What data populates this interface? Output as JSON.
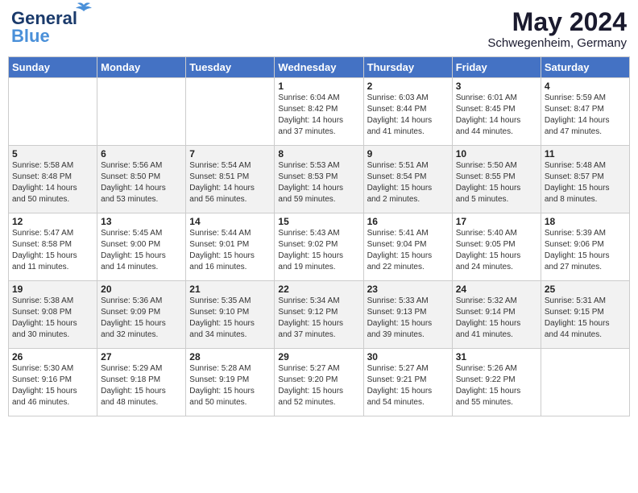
{
  "logo": {
    "line1": "General",
    "line2": "Blue"
  },
  "title": {
    "month_year": "May 2024",
    "location": "Schwegenheim, Germany"
  },
  "weekdays": [
    "Sunday",
    "Monday",
    "Tuesday",
    "Wednesday",
    "Thursday",
    "Friday",
    "Saturday"
  ],
  "rows": [
    [
      {
        "day": "",
        "info": ""
      },
      {
        "day": "",
        "info": ""
      },
      {
        "day": "",
        "info": ""
      },
      {
        "day": "1",
        "info": "Sunrise: 6:04 AM\nSunset: 8:42 PM\nDaylight: 14 hours\nand 37 minutes."
      },
      {
        "day": "2",
        "info": "Sunrise: 6:03 AM\nSunset: 8:44 PM\nDaylight: 14 hours\nand 41 minutes."
      },
      {
        "day": "3",
        "info": "Sunrise: 6:01 AM\nSunset: 8:45 PM\nDaylight: 14 hours\nand 44 minutes."
      },
      {
        "day": "4",
        "info": "Sunrise: 5:59 AM\nSunset: 8:47 PM\nDaylight: 14 hours\nand 47 minutes."
      }
    ],
    [
      {
        "day": "5",
        "info": "Sunrise: 5:58 AM\nSunset: 8:48 PM\nDaylight: 14 hours\nand 50 minutes."
      },
      {
        "day": "6",
        "info": "Sunrise: 5:56 AM\nSunset: 8:50 PM\nDaylight: 14 hours\nand 53 minutes."
      },
      {
        "day": "7",
        "info": "Sunrise: 5:54 AM\nSunset: 8:51 PM\nDaylight: 14 hours\nand 56 minutes."
      },
      {
        "day": "8",
        "info": "Sunrise: 5:53 AM\nSunset: 8:53 PM\nDaylight: 14 hours\nand 59 minutes."
      },
      {
        "day": "9",
        "info": "Sunrise: 5:51 AM\nSunset: 8:54 PM\nDaylight: 15 hours\nand 2 minutes."
      },
      {
        "day": "10",
        "info": "Sunrise: 5:50 AM\nSunset: 8:55 PM\nDaylight: 15 hours\nand 5 minutes."
      },
      {
        "day": "11",
        "info": "Sunrise: 5:48 AM\nSunset: 8:57 PM\nDaylight: 15 hours\nand 8 minutes."
      }
    ],
    [
      {
        "day": "12",
        "info": "Sunrise: 5:47 AM\nSunset: 8:58 PM\nDaylight: 15 hours\nand 11 minutes."
      },
      {
        "day": "13",
        "info": "Sunrise: 5:45 AM\nSunset: 9:00 PM\nDaylight: 15 hours\nand 14 minutes."
      },
      {
        "day": "14",
        "info": "Sunrise: 5:44 AM\nSunset: 9:01 PM\nDaylight: 15 hours\nand 16 minutes."
      },
      {
        "day": "15",
        "info": "Sunrise: 5:43 AM\nSunset: 9:02 PM\nDaylight: 15 hours\nand 19 minutes."
      },
      {
        "day": "16",
        "info": "Sunrise: 5:41 AM\nSunset: 9:04 PM\nDaylight: 15 hours\nand 22 minutes."
      },
      {
        "day": "17",
        "info": "Sunrise: 5:40 AM\nSunset: 9:05 PM\nDaylight: 15 hours\nand 24 minutes."
      },
      {
        "day": "18",
        "info": "Sunrise: 5:39 AM\nSunset: 9:06 PM\nDaylight: 15 hours\nand 27 minutes."
      }
    ],
    [
      {
        "day": "19",
        "info": "Sunrise: 5:38 AM\nSunset: 9:08 PM\nDaylight: 15 hours\nand 30 minutes."
      },
      {
        "day": "20",
        "info": "Sunrise: 5:36 AM\nSunset: 9:09 PM\nDaylight: 15 hours\nand 32 minutes."
      },
      {
        "day": "21",
        "info": "Sunrise: 5:35 AM\nSunset: 9:10 PM\nDaylight: 15 hours\nand 34 minutes."
      },
      {
        "day": "22",
        "info": "Sunrise: 5:34 AM\nSunset: 9:12 PM\nDaylight: 15 hours\nand 37 minutes."
      },
      {
        "day": "23",
        "info": "Sunrise: 5:33 AM\nSunset: 9:13 PM\nDaylight: 15 hours\nand 39 minutes."
      },
      {
        "day": "24",
        "info": "Sunrise: 5:32 AM\nSunset: 9:14 PM\nDaylight: 15 hours\nand 41 minutes."
      },
      {
        "day": "25",
        "info": "Sunrise: 5:31 AM\nSunset: 9:15 PM\nDaylight: 15 hours\nand 44 minutes."
      }
    ],
    [
      {
        "day": "26",
        "info": "Sunrise: 5:30 AM\nSunset: 9:16 PM\nDaylight: 15 hours\nand 46 minutes."
      },
      {
        "day": "27",
        "info": "Sunrise: 5:29 AM\nSunset: 9:18 PM\nDaylight: 15 hours\nand 48 minutes."
      },
      {
        "day": "28",
        "info": "Sunrise: 5:28 AM\nSunset: 9:19 PM\nDaylight: 15 hours\nand 50 minutes."
      },
      {
        "day": "29",
        "info": "Sunrise: 5:27 AM\nSunset: 9:20 PM\nDaylight: 15 hours\nand 52 minutes."
      },
      {
        "day": "30",
        "info": "Sunrise: 5:27 AM\nSunset: 9:21 PM\nDaylight: 15 hours\nand 54 minutes."
      },
      {
        "day": "31",
        "info": "Sunrise: 5:26 AM\nSunset: 9:22 PM\nDaylight: 15 hours\nand 55 minutes."
      },
      {
        "day": "",
        "info": ""
      }
    ]
  ]
}
